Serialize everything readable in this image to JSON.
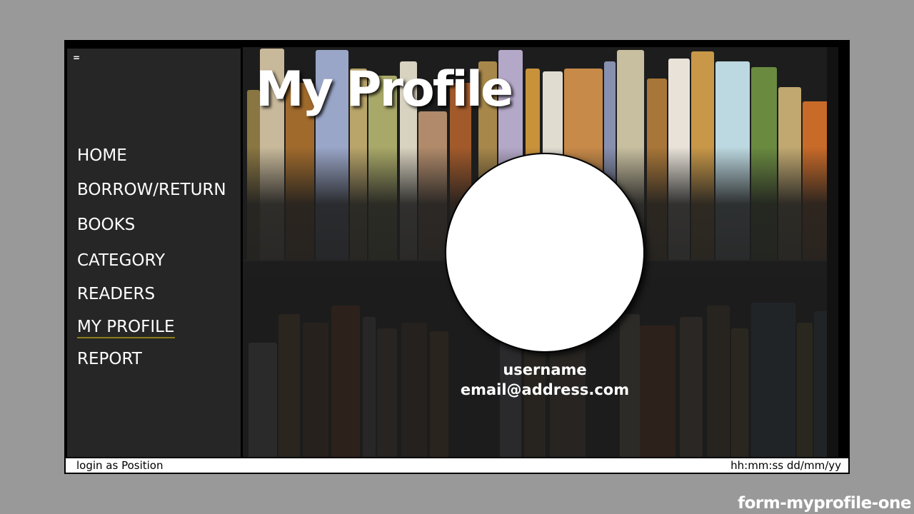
{
  "menu": {
    "toggle_glyph": "="
  },
  "nav": {
    "items": [
      {
        "label": "HOME"
      },
      {
        "label": "BORROW/RETURN"
      },
      {
        "label": "BOOKS"
      },
      {
        "label": "CATEGORY"
      },
      {
        "label": "READERS"
      },
      {
        "label": "MY PROFILE",
        "active": true
      },
      {
        "label": "REPORT"
      }
    ]
  },
  "page": {
    "title": "My Profile"
  },
  "profile": {
    "username": "username",
    "email": "email@address.com",
    "avatar": "profile-picture-placeholder"
  },
  "status": {
    "login": "login as Position",
    "datetime": "hh:mm:ss dd/mm/yy"
  },
  "form_name": "form-myprofile-one",
  "colors": {
    "page_bg": "#999999",
    "sidebar_bg": "#262626",
    "active_underline": "#8b7f18",
    "status_bg": "#ffffff"
  }
}
